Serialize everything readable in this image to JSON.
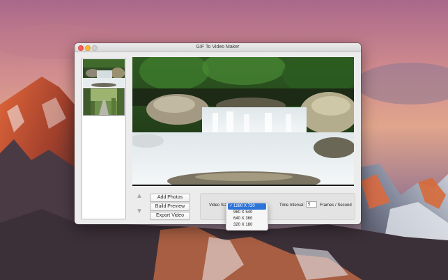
{
  "window": {
    "title": "GIF To Video Maker"
  },
  "buttons": {
    "add_photos": "Add Photos",
    "build_preview": "Build Preview",
    "export_video": "Export Video"
  },
  "settings": {
    "video_size_label": "Video Size:",
    "time_interval_label": "Time Interval:",
    "time_interval_value": "5",
    "fps_label": "Frames / Second",
    "video_size_options": [
      "1280 X 720",
      "960 X 540",
      "640 X 360",
      "320 X 180"
    ],
    "video_size_selected": "1280 X 720",
    "check_glyph": "✓"
  },
  "icons": {
    "move_up": "move-up-icon",
    "move_down": "move-down-icon"
  },
  "colors": {
    "selection_blue": "#2d74da",
    "close": "#fc5f57",
    "minimize": "#fdbc2e",
    "zoom_inactive": "#d0d0d0"
  }
}
